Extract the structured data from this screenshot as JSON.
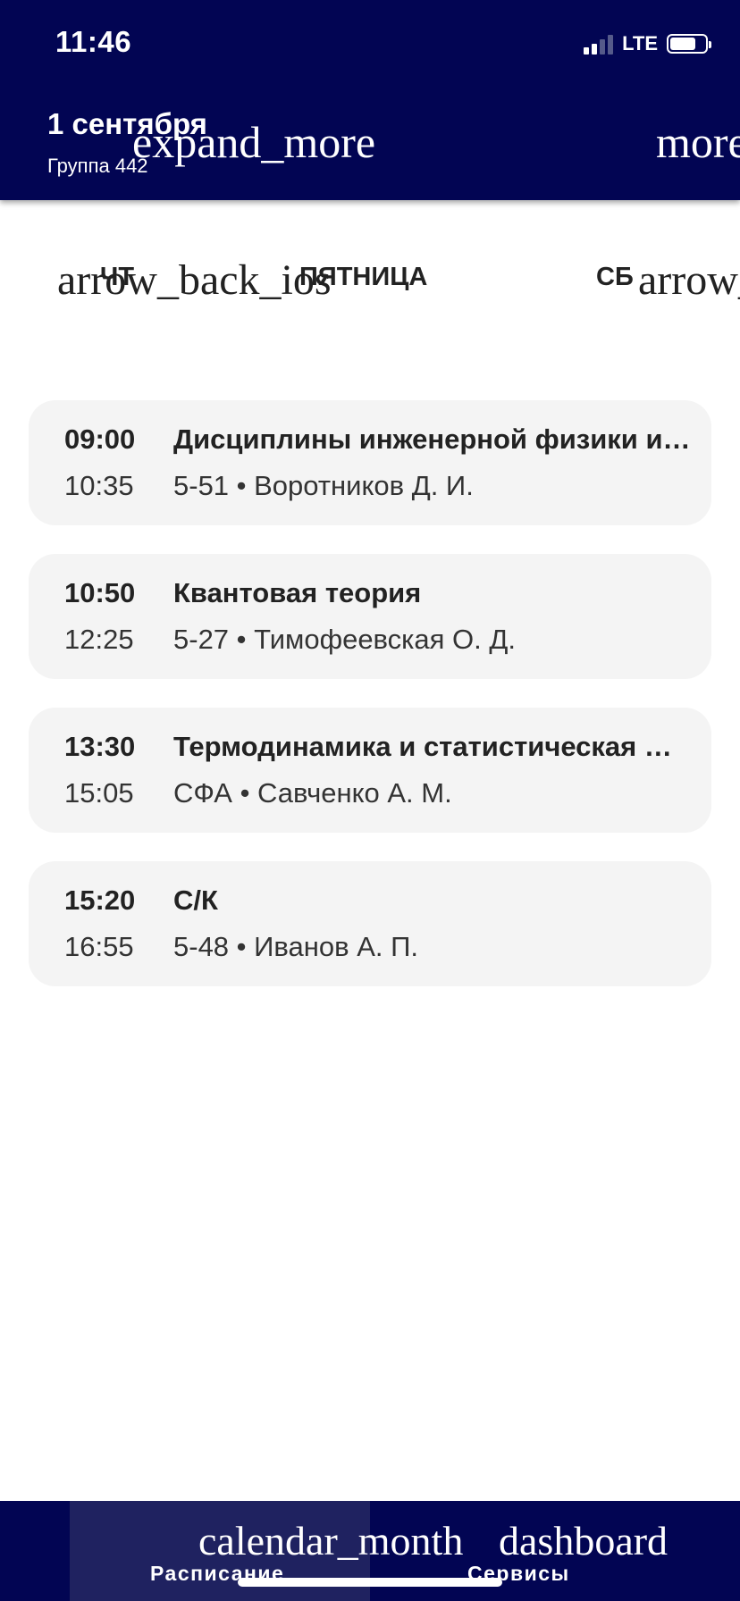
{
  "status_bar": {
    "time": "11:46",
    "network": "LTE",
    "signal_icon": "signal-icon",
    "battery_icon": "battery-icon"
  },
  "header": {
    "title": "1 сентября",
    "group": "Группа 442",
    "expand_icon": "expand_more",
    "more_icon": "more",
    "background": "#020553"
  },
  "day_nav": {
    "prev_icon": "arrow_back_ios",
    "prev_label": "ЧТ",
    "current": "ПЯТНИЦА",
    "next_label": "СБ",
    "next_icon": "arrow_"
  },
  "lessons": [
    {
      "start": "09:00",
      "end": "10:35",
      "title": "Дисциплины инженерной физики и математики",
      "details": "5-51 • Воротников Д. И."
    },
    {
      "start": "10:50",
      "end": "12:25",
      "title": "Квантовая теория",
      "details": "5-27 • Тимофеевская О. Д."
    },
    {
      "start": "13:30",
      "end": "15:05",
      "title": "Термодинамика и статистическая физика",
      "details": "СФА • Савченко А. М."
    },
    {
      "start": "15:20",
      "end": "16:55",
      "title": "С/К",
      "details": "5-48 • Иванов А. П."
    }
  ],
  "bottom_nav": {
    "tabs": [
      {
        "icon": "calendar_month",
        "label": "Расписание",
        "active": true
      },
      {
        "icon": "dashboard",
        "label": "Сервисы",
        "active": false
      }
    ],
    "active_tab_color": "#1f2260"
  }
}
